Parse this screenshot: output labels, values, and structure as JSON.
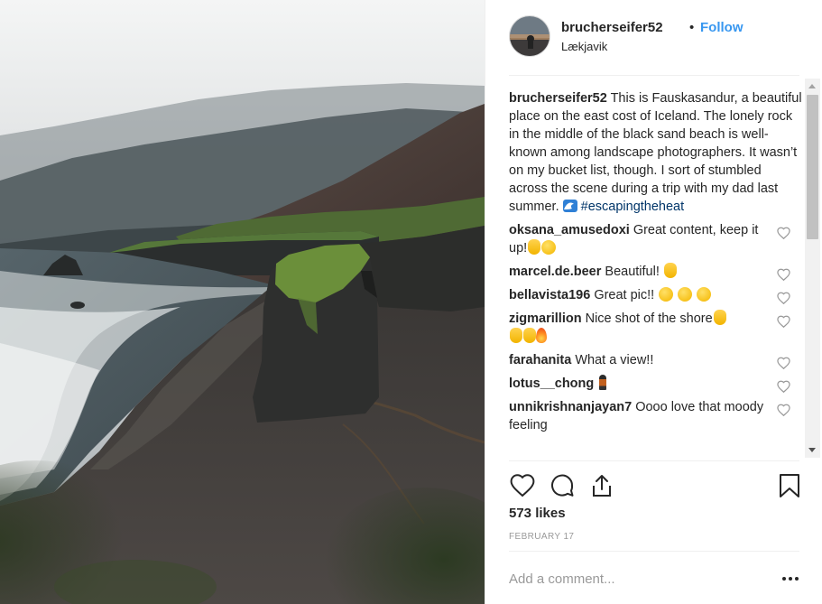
{
  "post": {
    "image_alt": "Fauskasandur black sand beach with lone sea stack",
    "header": {
      "username": "brucherseifer52",
      "separator": "•",
      "follow_label": "Follow",
      "location": "Lækjavik"
    },
    "caption": {
      "username": "brucherseifer52",
      "text": " This is Fauskasandur, a beautiful place on the east cost of Iceland. The lonely rock in the middle of the black sand beach is well-known among landscape photographers. It wasn’t on my bucket list, though. I sort of stumbled across the scene during a trip with my dad last summer. ",
      "emoji": "wave",
      "hashtag": "#escapingtheheat"
    },
    "comments": [
      {
        "username": "oksana_amusedoxi",
        "text": " Great content, keep it up!",
        "emoji": [
          "rock-hand",
          "wink-face"
        ]
      },
      {
        "username": "marcel.de.beer",
        "text": " Beautiful! ",
        "emoji": [
          "ok-hand"
        ]
      },
      {
        "username": "bellavista196",
        "text": " Great pic!! ",
        "emoji": [
          "hug-face",
          "hug-face",
          "hug-face"
        ]
      },
      {
        "username": "zigmarillion",
        "text": " Nice shot of the shore",
        "emoji": [
          "thumbs-up",
          "thumbs-up",
          "thumbs-up",
          "fire"
        ]
      },
      {
        "username": "farahanita",
        "text": " What a view!!",
        "emoji": []
      },
      {
        "username": "lotus__chong",
        "text": " ",
        "emoji": [
          "walking-person"
        ]
      },
      {
        "username": "unnikrishnanjayan7",
        "text": " Oooo love that moody feeling",
        "emoji": []
      }
    ],
    "likes": "573 likes",
    "date": "FEBRUARY 17",
    "add_comment_placeholder": "Add a comment...",
    "icons": {
      "like": "heart-outline-icon",
      "comment": "speech-bubble-icon",
      "share": "share-upload-icon",
      "save": "bookmark-icon",
      "more": "more-dots-icon"
    },
    "colors": {
      "follow": "#3897f0",
      "hashtag": "#003569",
      "meta_gray": "#999999"
    }
  }
}
